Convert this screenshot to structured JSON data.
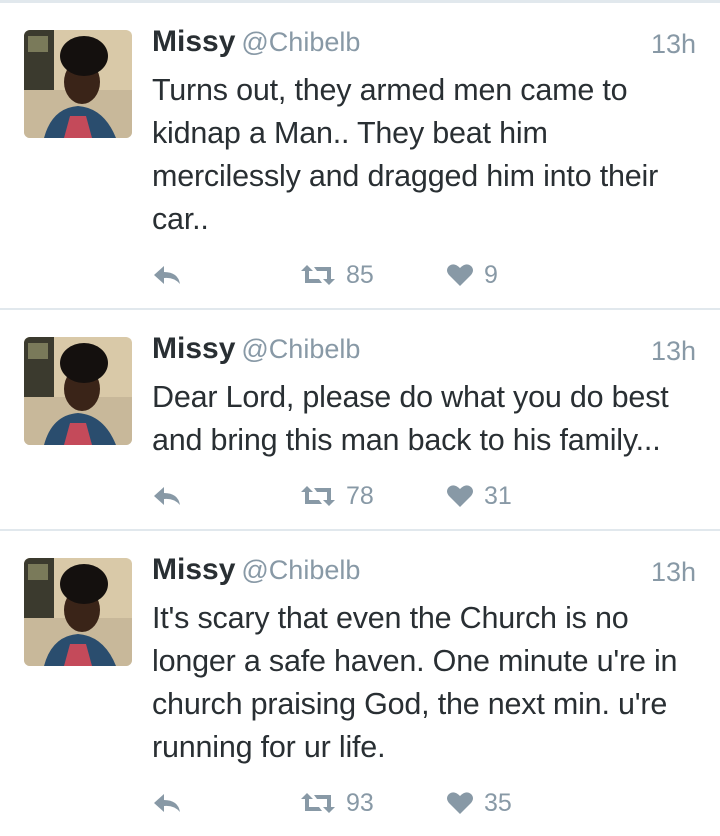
{
  "colors": {
    "muted": "#8899a6",
    "text": "#292f33",
    "divider": "#e1e8ed"
  },
  "tweets": [
    {
      "name": "Missy",
      "handle": "@Chibelb",
      "time": "13h",
      "text": "Turns out, they armed men came to kidnap a Man.. They beat him mercilessly and dragged him into their car..",
      "retweets": "85",
      "likes": "9"
    },
    {
      "name": "Missy",
      "handle": "@Chibelb",
      "time": "13h",
      "text": "Dear Lord, please do what you do best and bring this man back to his family...",
      "retweets": "78",
      "likes": "31"
    },
    {
      "name": "Missy",
      "handle": "@Chibelb",
      "time": "13h",
      "text": "It's scary that even the Church is no longer a safe haven. One minute u're in church praising God, the next min. u're running for ur life.",
      "retweets": "93",
      "likes": "35"
    }
  ],
  "icons": {
    "reply": "reply-icon",
    "retweet": "retweet-icon",
    "like": "heart-icon"
  }
}
